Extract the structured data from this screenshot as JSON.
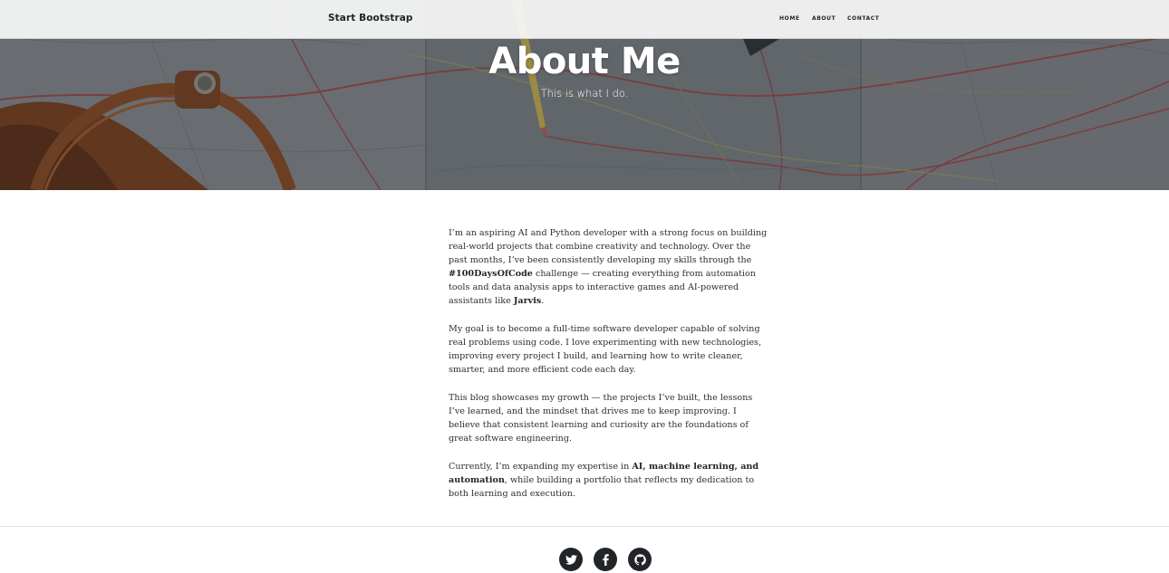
{
  "navbar": {
    "brand": "Start Bootstrap",
    "links": [
      {
        "label": "Home"
      },
      {
        "label": "About"
      },
      {
        "label": "Contact"
      }
    ]
  },
  "masthead": {
    "title": "About Me",
    "subtitle": "This is what I do."
  },
  "content": {
    "paragraphs": [
      {
        "segments": [
          {
            "text": "I’m an aspiring AI and Python developer with a strong focus on building real-world projects that combine creativity and technology. Over the past months, I’ve been consistently developing my skills through the ",
            "bold": false
          },
          {
            "text": "#100DaysOfCode",
            "bold": true
          },
          {
            "text": " challenge — creating everything from automation tools and data analysis apps to interactive games and AI-powered assistants like ",
            "bold": false
          },
          {
            "text": "Jarvis",
            "bold": true
          },
          {
            "text": ".",
            "bold": false
          }
        ]
      },
      {
        "segments": [
          {
            "text": "My goal is to become a full-time software developer capable of solving real problems using code. I love experimenting with new technologies, improving every project I build, and learning how to write cleaner, smarter, and more efficient code each day.",
            "bold": false
          }
        ]
      },
      {
        "segments": [
          {
            "text": "This blog showcases my growth — the projects I’ve built, the lessons I’ve learned, and the mindset that drives me to keep improving. I believe that consistent learning and curiosity are the foundations of great software engineering.",
            "bold": false
          }
        ]
      },
      {
        "segments": [
          {
            "text": "Currently, I’m expanding my expertise in ",
            "bold": false
          },
          {
            "text": "AI, machine learning, and automation",
            "bold": true
          },
          {
            "text": ", while building a portfolio that reflects my dedication to both learning and execution.",
            "bold": false
          }
        ]
      }
    ]
  },
  "footer": {
    "social": [
      {
        "icon": "twitter-icon"
      },
      {
        "icon": "facebook-icon"
      },
      {
        "icon": "github-icon"
      }
    ]
  },
  "colors": {
    "text": "#212529",
    "navbar_bg": "#f8f8f8",
    "social_bg": "#212529"
  }
}
